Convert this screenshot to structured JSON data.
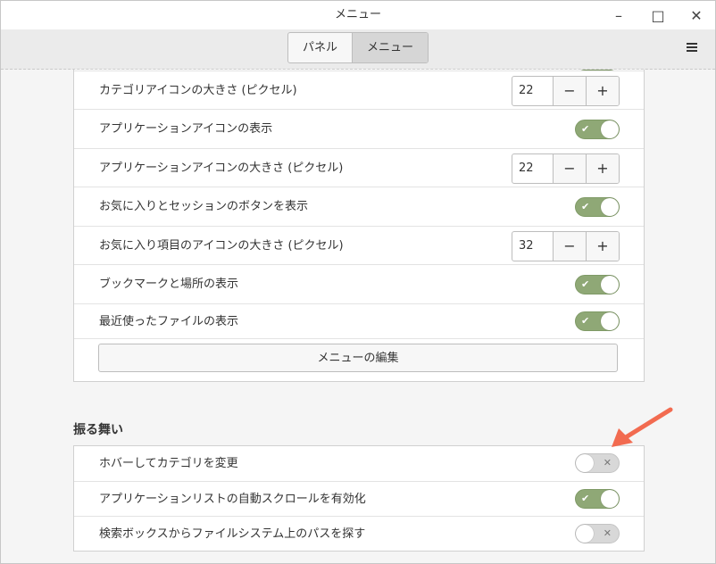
{
  "window": {
    "title": "メニュー"
  },
  "window_controls": {
    "minimize": "–",
    "maximize": "□",
    "close": "✕"
  },
  "tabs": [
    {
      "label": "パネル",
      "active": false
    },
    {
      "label": "メニュー",
      "active": true
    }
  ],
  "top_section": {
    "rows": [
      {
        "label": "カテゴリアイコンの大きさ (ピクセル)",
        "type": "spin",
        "value": "22"
      },
      {
        "label": "アプリケーションアイコンの表示",
        "type": "switch",
        "state": "on"
      },
      {
        "label": "アプリケーションアイコンの大きさ (ピクセル)",
        "type": "spin",
        "value": "22"
      },
      {
        "label": "お気に入りとセッションのボタンを表示",
        "type": "switch",
        "state": "on"
      },
      {
        "label": "お気に入り項目のアイコンの大きさ (ピクセル)",
        "type": "spin",
        "value": "32"
      },
      {
        "label": "ブックマークと場所の表示",
        "type": "switch",
        "state": "on"
      },
      {
        "label": "最近使ったファイルの表示",
        "type": "switch",
        "state": "on"
      }
    ],
    "edit_button_label": "メニューの編集"
  },
  "behavior_section": {
    "title": "振る舞い",
    "rows": [
      {
        "label": "ホバーしてカテゴリを変更",
        "state": "off"
      },
      {
        "label": "アプリケーションリストの自動スクロールを有効化",
        "state": "on"
      },
      {
        "label": "検索ボックスからファイルシステム上のパスを探す",
        "state": "off"
      }
    ]
  },
  "spin_symbols": {
    "minus": "−",
    "plus": "+"
  },
  "switch_marks": {
    "on": "✔",
    "off": "✕"
  },
  "colors": {
    "switch_on": "#8fa876",
    "switch_off": "#d8d8d8",
    "annotation_arrow": "#f26b50"
  },
  "icons": {
    "menu": "hamburger-icon",
    "annotation": "arrow-annotation"
  }
}
